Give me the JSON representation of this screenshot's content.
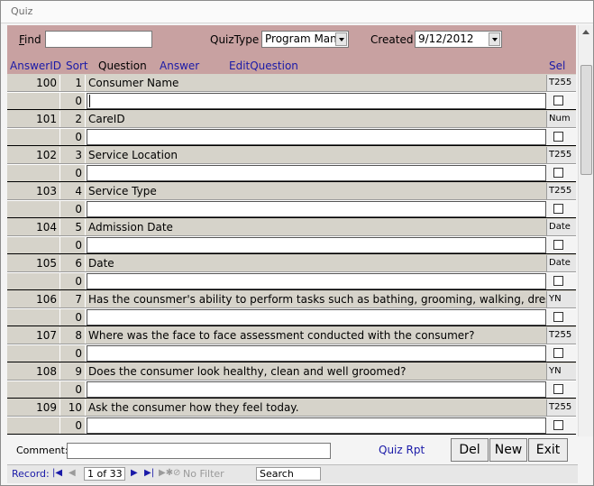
{
  "window": {
    "title": "Quiz"
  },
  "header": {
    "find_label_first": "F",
    "find_label_rest": "ind",
    "find_value": "",
    "quiztype_label": "QuizType",
    "quiztype_value": "Program Man",
    "created_label": "Created",
    "created_value": "9/12/2012"
  },
  "columns": {
    "answer_id": "AnswerID",
    "sort": "Sort",
    "question": "Question",
    "answer": "Answer",
    "edit_question": "EditQuestion",
    "sel": "Sel"
  },
  "rows": [
    {
      "answer_id": "100",
      "sort": "1",
      "question": "Consumer Name",
      "type": "T255",
      "answer_sort": "0",
      "answer": ""
    },
    {
      "answer_id": "101",
      "sort": "2",
      "question": "CareID",
      "type": "Num",
      "answer_sort": "0",
      "answer": ""
    },
    {
      "answer_id": "102",
      "sort": "3",
      "question": "Service Location",
      "type": "T255",
      "answer_sort": "0",
      "answer": ""
    },
    {
      "answer_id": "103",
      "sort": "4",
      "question": "Service Type",
      "type": "T255",
      "answer_sort": "0",
      "answer": ""
    },
    {
      "answer_id": "104",
      "sort": "5",
      "question": "Admission Date",
      "type": "Date",
      "answer_sort": "0",
      "answer": ""
    },
    {
      "answer_id": "105",
      "sort": "6",
      "question": "Date",
      "type": "Date",
      "answer_sort": "0",
      "answer": ""
    },
    {
      "answer_id": "106",
      "sort": "7",
      "question": "Has the counsmer's ability to perform tasks such as bathing, grooming, walking, dressing",
      "type": "YN",
      "answer_sort": "0",
      "answer": ""
    },
    {
      "answer_id": "107",
      "sort": "8",
      "question": "Where was the face to face assessment conducted with the consumer?",
      "type": "T255",
      "answer_sort": "0",
      "answer": ""
    },
    {
      "answer_id": "108",
      "sort": "9",
      "question": "Does the consumer look healthy, clean and well groomed?",
      "type": "YN",
      "answer_sort": "0",
      "answer": ""
    },
    {
      "answer_id": "109",
      "sort": "10",
      "question": "Ask the consumer how they feel today.",
      "type": "T255",
      "answer_sort": "0",
      "answer": ""
    }
  ],
  "footer": {
    "comment_label": "Comment:",
    "comment_value": "",
    "quiz_rpt": "Quiz Rpt",
    "del_label": "Del",
    "new_label": "New",
    "exit_label": "Exit"
  },
  "navbar": {
    "record_label": "Record:",
    "position": "1 of 33",
    "no_filter": "No Filter",
    "search": "Search"
  }
}
